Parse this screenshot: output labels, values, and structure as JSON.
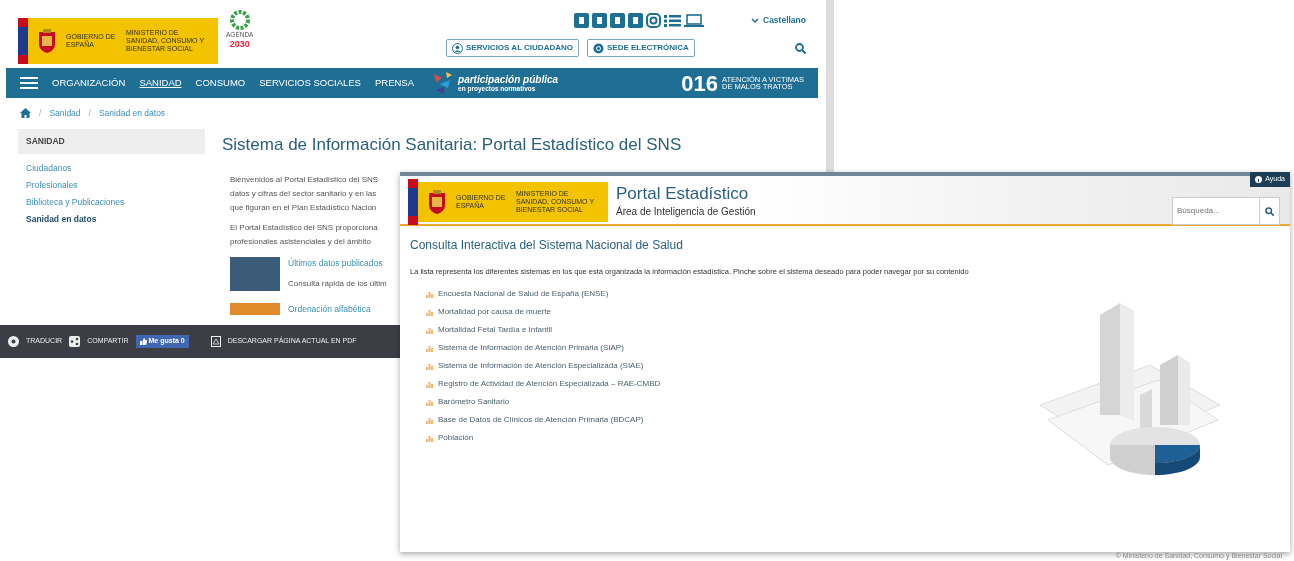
{
  "back_window": {
    "logo": {
      "government": "GOBIERNO DE ESPAÑA",
      "ministry": "MINISTERIO DE SANIDAD, CONSUMO Y BIENESTAR SOCIAL",
      "agenda": "AGENDA",
      "year": "2030"
    },
    "language": "Castellano",
    "service_buttons": [
      {
        "label": "SERVICIOS AL CIUDADANO",
        "kind": "people"
      },
      {
        "label": "SEDE ELECTRÓNICA",
        "kind": "at"
      }
    ],
    "nav": [
      {
        "label": "ORGANIZACIÓN",
        "selected": false
      },
      {
        "label": "SANIDAD",
        "selected": true
      },
      {
        "label": "CONSUMO",
        "selected": false
      },
      {
        "label": "SERVICIOS SOCIALES",
        "selected": false
      },
      {
        "label": "PRENSA",
        "selected": false
      }
    ],
    "banner": {
      "title": "participación pública",
      "subtitle": "en proyectos normativos"
    },
    "hotline": {
      "number": "016",
      "text": "ATENCIÓN A VICTIMAS\nDE MALOS TRATOS"
    },
    "breadcrumb": [
      {
        "separator": "/",
        "label": "Sanidad"
      },
      {
        "separator": "/",
        "label": "Sanidad en datos"
      }
    ],
    "sidebar": {
      "title": "SANIDAD",
      "items": [
        {
          "label": "Ciudadanos",
          "selected": false
        },
        {
          "label": "Profesionales",
          "selected": false
        },
        {
          "label": "Biblioteca y Publicaciones",
          "selected": false
        },
        {
          "label": "Sanidad en datos",
          "selected": true
        }
      ]
    },
    "main": {
      "title": "Sistema de Información Sanitaria: Portal Estadístico del SNS",
      "paragraphs": [
        "Bienvenidos al Portal Estadístico del SNS\ndatos y cifras del sector sanitario y en las\nque figuran en el Plan Estadístico Nacion",
        "El Portal Estadístico del SNS proporciona\nprofesionales asistenciales y del ámbito"
      ],
      "features": [
        {
          "title": "Últimos datos publicados",
          "description": "Consulta rápida de los últim",
          "kind": "photo"
        },
        {
          "title": "Ordenación alfabética",
          "kind": "orange"
        }
      ]
    },
    "share_bar": {
      "translate": "TRADUCIR",
      "share": "COMPARTIR",
      "like": "Me gusta 0",
      "pdf": "DESCARGAR PÁGINA ACTUAL EN PDF"
    }
  },
  "front_window": {
    "logo": {
      "government": "GOBIERNO DE ESPAÑA",
      "ministry": "MINISTERIO DE SANIDAD, CONSUMO Y BIENESTAR SOCIAL"
    },
    "title": "Portal Estadístico",
    "subtitle": "Área de Inteligencia de Gestión",
    "help_button": "Ayuda",
    "search": {
      "placeholder": "Búsqueda..."
    },
    "heading": "Consulta Interactiva del Sistema Nacional de Salud",
    "description": "La lista representa los diferentes sistemas en los que está organizada la información estadística. Pinche sobre el sistema deseado para poder navegar por su contenido",
    "systems": [
      "Encuesta Nacional de Salud de España (ENSE)",
      "Mortalidad por causa de muerte",
      "Mortalidad Fetal Tardía e Infantil",
      "Sistema de Información de Atención Primaria (SIAP)",
      "Sistema de Información de Atención Especializada (SIAE)",
      "Registro de Actividad de Atención Especializada – RAE-CMBD",
      "Barómetro Sanitario",
      "Base de Datos de Clínicos de Atención Primaria (BDCAP)",
      "Población"
    ]
  },
  "footer": "© Ministerio de Sanidad, Consumo y Bienestar Social"
}
